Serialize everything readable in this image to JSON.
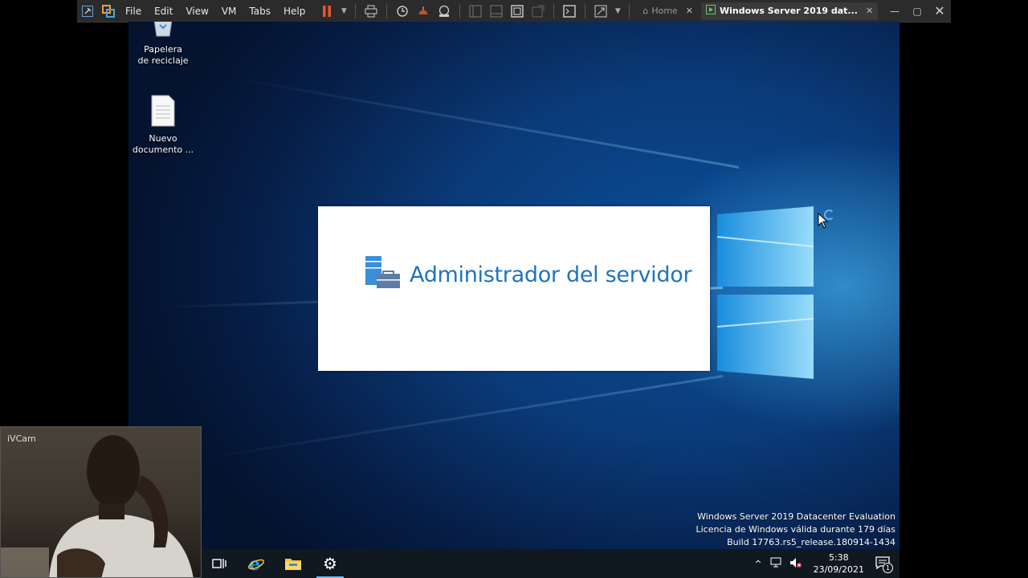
{
  "vmware": {
    "menus": [
      "File",
      "Edit",
      "View",
      "VM",
      "Tabs",
      "Help"
    ],
    "tabs": [
      {
        "label": "Home",
        "active": false
      },
      {
        "label": "Windows Server 2019 dat...",
        "active": true
      }
    ],
    "accent_pause": "#e8572a"
  },
  "desktop": {
    "icons": [
      {
        "label": "Papelera de reciclaje",
        "icon": "recycle-bin-icon"
      },
      {
        "label": "Nuevo documento ...",
        "icon": "document-icon"
      }
    ],
    "splash": {
      "title": "Administrador del servidor",
      "icon": "server-manager-icon",
      "color": "#1e74bd"
    },
    "watermark": [
      "Windows Server 2019 Datacenter Evaluation",
      "Licencia de Windows válida durante 179 días",
      "Build 17763.rs5_release.180914-1434"
    ]
  },
  "taskbar": {
    "apps": [
      "task-view-icon",
      "internet-explorer-icon",
      "file-explorer-icon",
      "settings-icon"
    ],
    "clock": {
      "time": "5:38",
      "date": "23/09/2021"
    },
    "notifications": "1"
  },
  "webcam": {
    "label": "iVCam"
  }
}
